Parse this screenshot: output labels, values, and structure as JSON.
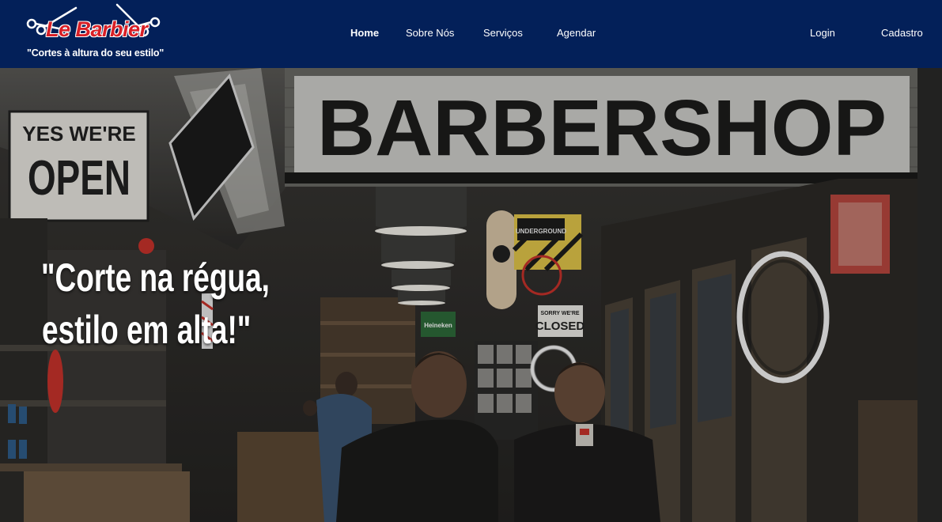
{
  "header": {
    "logo": {
      "title": "Le Barbier",
      "tagline": "\"Cortes à altura do seu estilo\"",
      "icon": "scissors-icon"
    },
    "nav": [
      {
        "label": "Home",
        "active": true
      },
      {
        "label": "Sobre Nós",
        "active": false
      },
      {
        "label": "Serviços",
        "active": false
      },
      {
        "label": "Agendar",
        "active": false
      }
    ],
    "auth": {
      "login_label": "Login",
      "signup_label": "Cadastro"
    }
  },
  "hero": {
    "quote_line1": "\"Corte na régua,",
    "quote_line2": "estilo em alta!\"",
    "background": {
      "sign_main": "BARBERSHOP",
      "sign_open_line1": "YES WE'RE",
      "sign_open_line2": "OPEN",
      "sign_closed_line1": "SORRY WE'RE",
      "sign_closed_line2": "CLOSED",
      "sign_underground": "UNDERGROUND",
      "sign_heineken": "Heineken"
    }
  },
  "colors": {
    "navbar": "#032059",
    "logo_red": "#d81f26",
    "text": "#ffffff"
  }
}
